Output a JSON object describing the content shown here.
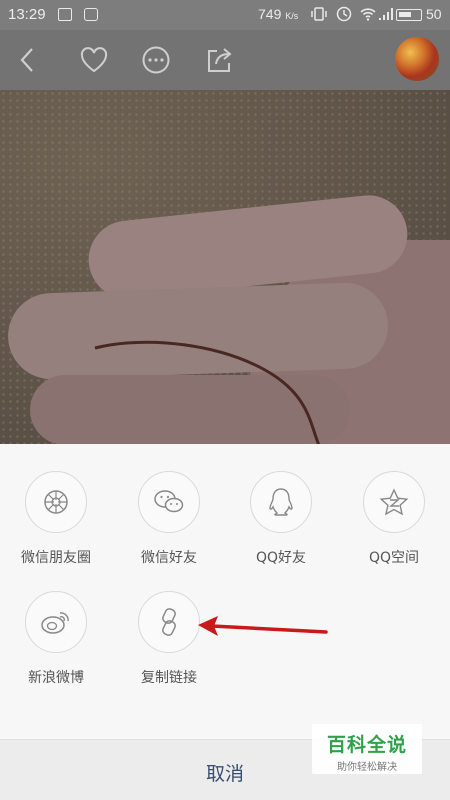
{
  "status_bar": {
    "time": "13:29",
    "net_speed": "749",
    "net_speed_unit": "K/s",
    "battery": "50"
  },
  "toolbar": {
    "icons": [
      "back-icon",
      "heart-icon",
      "more-icon",
      "share-icon",
      "avatar"
    ]
  },
  "share_sheet": {
    "items": [
      {
        "label": "微信朋友圈",
        "icon": "wechat-moments-icon"
      },
      {
        "label": "微信好友",
        "icon": "wechat-icon"
      },
      {
        "label": "QQ好友",
        "icon": "qq-icon"
      },
      {
        "label": "QQ空间",
        "icon": "qzone-icon"
      },
      {
        "label": "新浪微博",
        "icon": "weibo-icon"
      },
      {
        "label": "复制链接",
        "icon": "link-icon"
      }
    ],
    "cancel_label": "取消"
  },
  "annotation": {
    "arrow_color": "#c8191b"
  },
  "watermark": {
    "title": "百科全说",
    "subtitle": "助你轻松解决"
  }
}
